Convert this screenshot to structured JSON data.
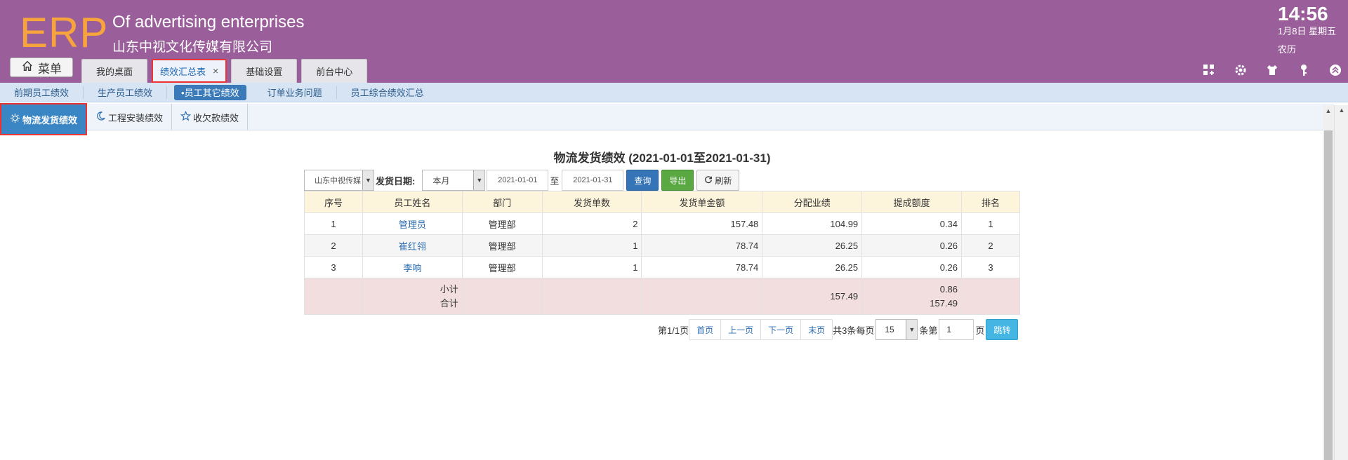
{
  "header": {
    "logo": "ERP",
    "company_en": "Of advertising enterprises",
    "company_cn": "山东中视文化传媒有限公司",
    "time": "14:56",
    "date": "1月8日 星期五",
    "lunar": "农历",
    "menu_label": "菜单",
    "tabs": [
      {
        "label": "我的桌面"
      },
      {
        "label": "绩效汇总表",
        "active": true,
        "close": "×"
      },
      {
        "label": "基础设置"
      },
      {
        "label": "前台中心"
      }
    ],
    "icons": [
      "apps-add-icon",
      "gear-icon",
      "shirt-icon",
      "key-icon",
      "collapse-up-icon"
    ]
  },
  "subnav": {
    "items": [
      {
        "label": "前期员工绩效"
      },
      {
        "label": "生产员工绩效"
      },
      {
        "label": "•员工其它绩效",
        "active": true
      },
      {
        "label": "订单业务问题"
      },
      {
        "label": "员工综合绩效汇总"
      }
    ]
  },
  "third_tabs": [
    {
      "label": "物流发货绩效",
      "icon": "sun-icon",
      "active": true
    },
    {
      "label": "工程安装绩效",
      "icon": "moon-icon"
    },
    {
      "label": "收欠款绩效",
      "icon": "star-icon"
    }
  ],
  "report": {
    "title": "物流发货绩效 (2021-01-01至2021-01-31)",
    "company_select": "山东中视传媒",
    "date_label": "发货日期:",
    "period_select": "本月",
    "date_from": "2021-01-01",
    "to_label": "至",
    "date_to": "2021-01-31",
    "query_label": "查询",
    "export_label": "导出",
    "refresh_label": "刷新"
  },
  "table": {
    "headers": [
      "序号",
      "员工姓名",
      "部门",
      "发货单数",
      "发货单金额",
      "分配业绩",
      "提成额度",
      "排名"
    ],
    "rows": [
      {
        "idx": "1",
        "name": "管理员",
        "dept": "管理部",
        "count": "2",
        "amount": "157.48",
        "perf": "104.99",
        "bonus": "0.34",
        "rank": "1"
      },
      {
        "idx": "2",
        "name": "崔红翎",
        "dept": "管理部",
        "count": "1",
        "amount": "78.74",
        "perf": "26.25",
        "bonus": "0.26",
        "rank": "2"
      },
      {
        "idx": "3",
        "name": "李响",
        "dept": "管理部",
        "count": "1",
        "amount": "78.74",
        "perf": "26.25",
        "bonus": "0.26",
        "rank": "3"
      }
    ],
    "summary": {
      "subtotal_label": "小计",
      "total_label": "合计",
      "perf": "157.49",
      "bonus_subtotal": "0.86",
      "bonus_total": "157.49"
    }
  },
  "pager": {
    "page_info": "第1/1页",
    "first": "首页",
    "prev": "上一页",
    "next": "下一页",
    "last": "末页",
    "total_text": "共3条每页",
    "page_size": "15",
    "goto_prefix": "条第",
    "goto_value": "1",
    "goto_suffix": "页",
    "jump_label": "跳转"
  }
}
